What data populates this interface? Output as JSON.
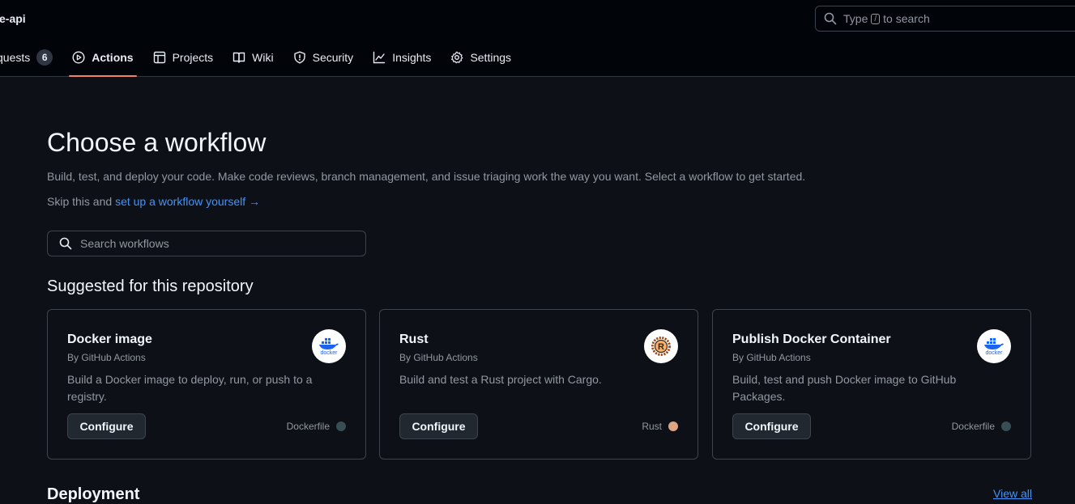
{
  "header": {
    "repo_name": "e-api",
    "search": {
      "prefix": "Type",
      "key": "/",
      "suffix": "to search"
    }
  },
  "tabs": [
    {
      "label": "quests",
      "counter": "6",
      "icon": "pull-request-icon"
    },
    {
      "label": "Actions",
      "icon": "play-icon",
      "active": true
    },
    {
      "label": "Projects",
      "icon": "table-icon"
    },
    {
      "label": "Wiki",
      "icon": "book-icon"
    },
    {
      "label": "Security",
      "icon": "shield-icon"
    },
    {
      "label": "Insights",
      "icon": "graph-icon"
    },
    {
      "label": "Settings",
      "icon": "gear-icon"
    }
  ],
  "main": {
    "title": "Choose a workflow",
    "subtitle": "Build, test, and deploy your code. Make code reviews, branch management, and issue triaging work the way you want. Select a workflow to get started.",
    "skip_prefix": "Skip this and ",
    "skip_link": "set up a workflow yourself",
    "skip_arrow": "→",
    "search_placeholder": "Search workflows",
    "suggested_heading": "Suggested for this repository",
    "deployment_heading": "Deployment",
    "view_all": "View all"
  },
  "cards": [
    {
      "title": "Docker image",
      "author": "By GitHub Actions",
      "description": "Build a Docker image to deploy, run, or push to a registry.",
      "button": "Configure",
      "language": "Dockerfile",
      "language_color": "#384d54",
      "logo": "docker-logo-icon",
      "logo_text": "docker"
    },
    {
      "title": "Rust",
      "author": "By GitHub Actions",
      "description": "Build and test a Rust project with Cargo.",
      "button": "Configure",
      "language": "Rust",
      "language_color": "#dea584",
      "logo": "rust-logo-icon",
      "logo_text": ""
    },
    {
      "title": "Publish Docker Container",
      "author": "By GitHub Actions",
      "description": "Build, test and push Docker image to GitHub Packages.",
      "button": "Configure",
      "language": "Dockerfile",
      "language_color": "#384d54",
      "logo": "docker-logo-icon",
      "logo_text": "docker"
    }
  ],
  "colors": {
    "background": "#0d1117",
    "header_bg": "#010409",
    "accent_link": "#4493f8",
    "active_underline": "#f78166"
  }
}
